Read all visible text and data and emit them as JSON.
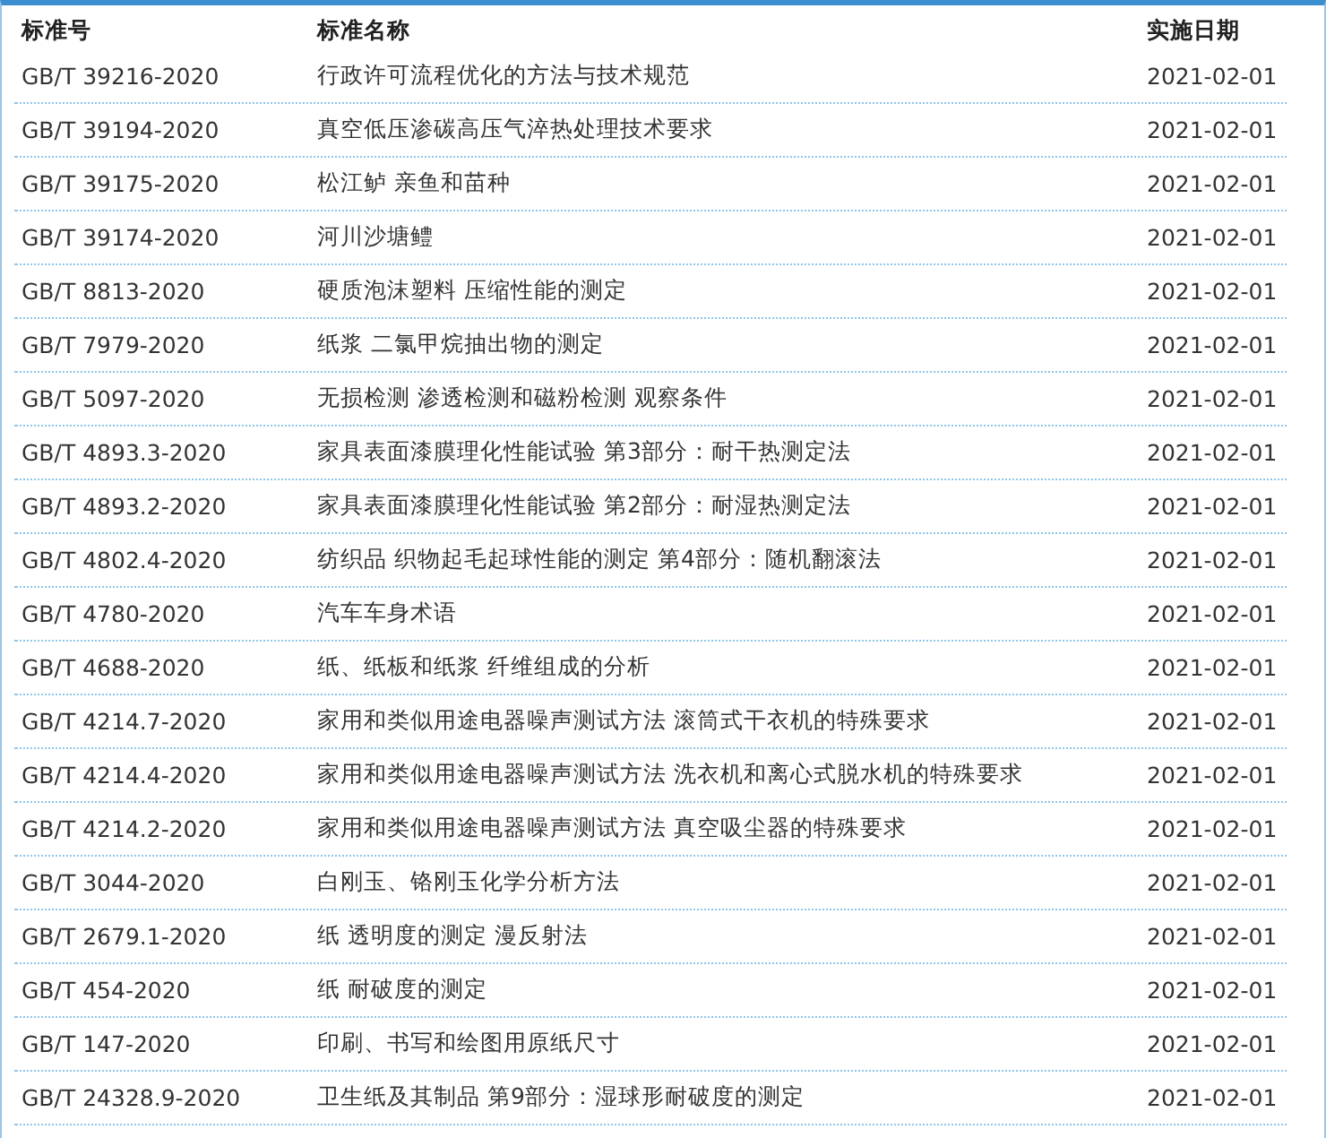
{
  "table": {
    "columns": [
      "标准号",
      "标准名称",
      "实施日期"
    ],
    "rows": [
      {
        "number": "GB/T 39216-2020",
        "name": "行政许可流程优化的方法与技术规范",
        "date": "2021-02-01"
      },
      {
        "number": "GB/T 39194-2020",
        "name": "真空低压渗碳高压气淬热处理技术要求",
        "date": "2021-02-01"
      },
      {
        "number": "GB/T 39175-2020",
        "name": "松江鲈 亲鱼和苗种",
        "date": "2021-02-01"
      },
      {
        "number": "GB/T 39174-2020",
        "name": "河川沙塘鳢",
        "date": "2021-02-01"
      },
      {
        "number": "GB/T 8813-2020",
        "name": "硬质泡沫塑料 压缩性能的测定",
        "date": "2021-02-01"
      },
      {
        "number": "GB/T 7979-2020",
        "name": "纸浆 二氯甲烷抽出物的测定",
        "date": "2021-02-01"
      },
      {
        "number": "GB/T 5097-2020",
        "name": "无损检测 渗透检测和磁粉检测 观察条件",
        "date": "2021-02-01"
      },
      {
        "number": "GB/T 4893.3-2020",
        "name": "家具表面漆膜理化性能试验 第3部分：耐干热测定法",
        "date": "2021-02-01"
      },
      {
        "number": "GB/T 4893.2-2020",
        "name": "家具表面漆膜理化性能试验 第2部分：耐湿热测定法",
        "date": "2021-02-01"
      },
      {
        "number": "GB/T 4802.4-2020",
        "name": "纺织品 织物起毛起球性能的测定 第4部分：随机翻滚法",
        "date": "2021-02-01"
      },
      {
        "number": "GB/T 4780-2020",
        "name": "汽车车身术语",
        "date": "2021-02-01"
      },
      {
        "number": "GB/T 4688-2020",
        "name": "纸、纸板和纸浆 纤维组成的分析",
        "date": "2021-02-01"
      },
      {
        "number": "GB/T 4214.7-2020",
        "name": "家用和类似用途电器噪声测试方法 滚筒式干衣机的特殊要求",
        "date": "2021-02-01"
      },
      {
        "number": "GB/T 4214.4-2020",
        "name": "家用和类似用途电器噪声测试方法 洗衣机和离心式脱水机的特殊要求",
        "date": "2021-02-01"
      },
      {
        "number": "GB/T 4214.2-2020",
        "name": "家用和类似用途电器噪声测试方法 真空吸尘器的特殊要求",
        "date": "2021-02-01"
      },
      {
        "number": "GB/T 3044-2020",
        "name": "白刚玉、铬刚玉化学分析方法",
        "date": "2021-02-01"
      },
      {
        "number": "GB/T 2679.1-2020",
        "name": "纸 透明度的测定 漫反射法",
        "date": "2021-02-01"
      },
      {
        "number": "GB/T 454-2020",
        "name": "纸 耐破度的测定",
        "date": "2021-02-01"
      },
      {
        "number": "GB/T 147-2020",
        "name": "印刷、书写和绘图用原纸尺寸",
        "date": "2021-02-01"
      },
      {
        "number": "GB/T 24328.9-2020",
        "name": "卫生纸及其制品 第9部分：湿球形耐破度的测定",
        "date": "2021-02-01"
      }
    ]
  }
}
